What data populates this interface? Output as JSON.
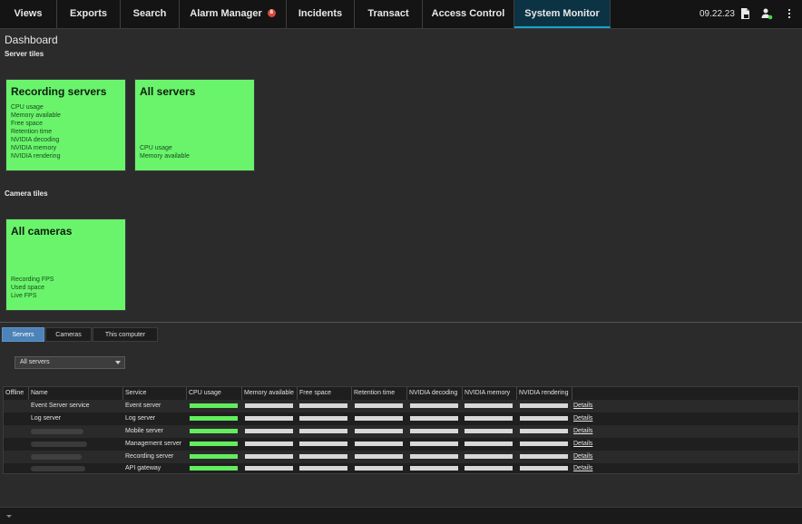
{
  "nav": {
    "tabs": [
      {
        "label": "Views"
      },
      {
        "label": "Exports"
      },
      {
        "label": "Search"
      },
      {
        "label": "Alarm Manager",
        "badge": "8"
      },
      {
        "label": "Incidents"
      },
      {
        "label": "Transact"
      },
      {
        "label": "Access Control"
      },
      {
        "label": "System Monitor",
        "active": true
      }
    ],
    "clock": "09.22.23",
    "icons": [
      "file-icon",
      "user-status-icon",
      "more-vertical-icon"
    ]
  },
  "dashboard": {
    "title": "Dashboard",
    "server_tiles_heading": "Server tiles",
    "camera_tiles_heading": "Camera tiles",
    "tiles": [
      {
        "title": "Recording servers",
        "color": "#69f46c",
        "lines": [
          "CPU usage",
          "Memory available",
          "Free space",
          "Retention time",
          "NVIDIA decoding",
          "NVIDIA memory",
          "NVIDIA rendering"
        ]
      },
      {
        "title": "All servers",
        "color": "#69f46c",
        "lines": [
          "CPU usage",
          "Memory available"
        ]
      },
      {
        "title": "All cameras",
        "color": "#69f46c",
        "lines": [
          "Recording FPS",
          "Used space",
          "Live FPS"
        ]
      }
    ]
  },
  "details_panel": {
    "tabs": [
      {
        "label": "Servers",
        "active": true
      },
      {
        "label": "Cameras"
      },
      {
        "label": "This computer"
      }
    ],
    "filter": {
      "selected": "All servers"
    },
    "table": {
      "columns": [
        "Offline",
        "Name",
        "Service",
        "CPU usage",
        "Memory available",
        "Free space",
        "Retention time",
        "NVIDIA decoding",
        "NVIDIA memory",
        "NVIDIA rendering"
      ],
      "rows": [
        {
          "name": "Event Server service",
          "service": "Event server",
          "cpu": "high",
          "details": "Details"
        },
        {
          "name": "Log server",
          "service": "Log server",
          "cpu": "high",
          "details": "Details"
        },
        {
          "name": "",
          "service": "Mobile server",
          "cpu": "high",
          "details": "Details"
        },
        {
          "name": "",
          "service": "Management server",
          "cpu": "high",
          "details": "Details"
        },
        {
          "name": "",
          "service": "Recording server",
          "cpu": "high",
          "details": "Details"
        },
        {
          "name": "",
          "service": "API gateway",
          "cpu": "high",
          "details": "Details"
        }
      ]
    }
  },
  "colors": {
    "accent": "#1aa3c9",
    "ok": "#69f46c",
    "bar_ok": "#63ed5e",
    "bar_neutral": "#d8d8d8",
    "badge": "#d64a3a"
  }
}
